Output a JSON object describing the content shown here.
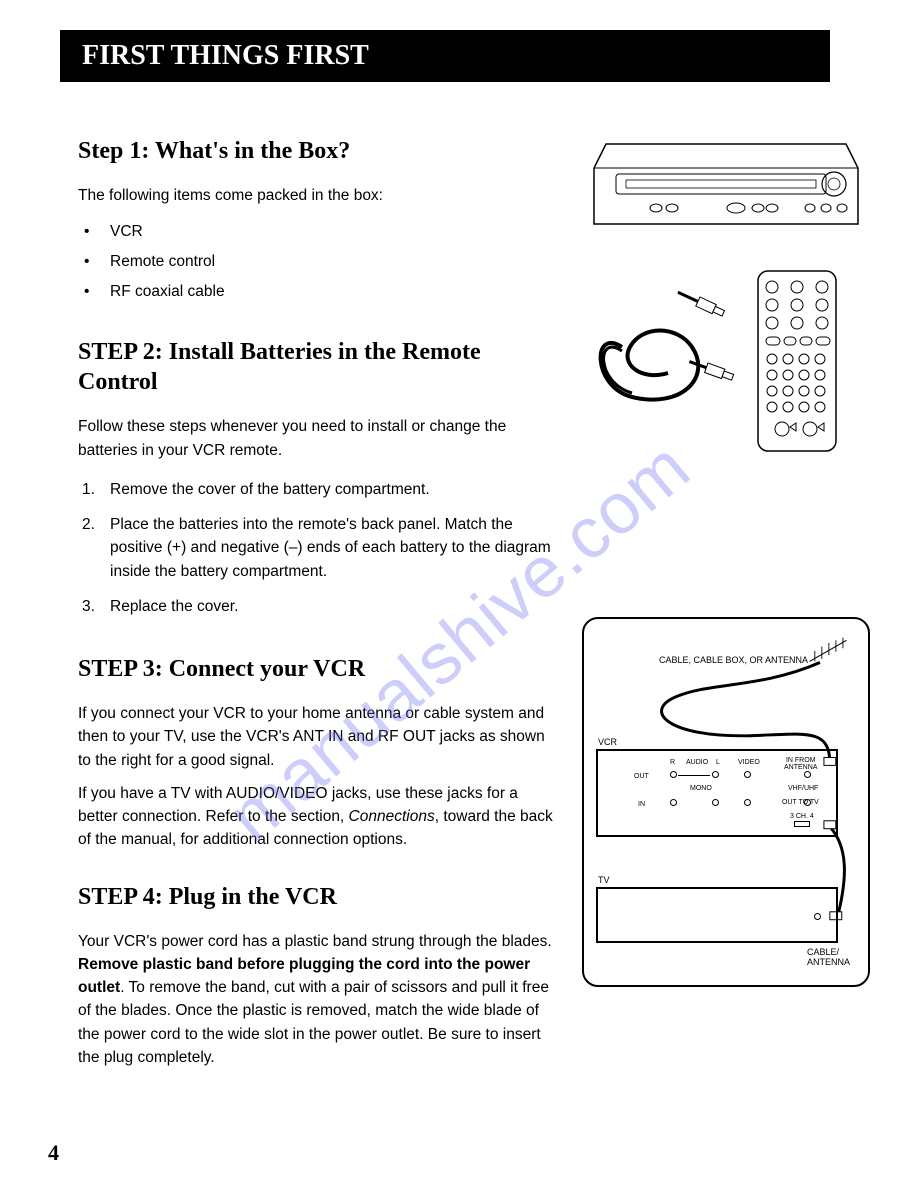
{
  "banner": "FIRST THINGS FIRST",
  "pageNumber": "4",
  "watermark": "manualshive.com",
  "step1": {
    "heading": "Step 1: What's in the Box?",
    "intro": "The following items come packed in the box:",
    "items": [
      "VCR",
      "Remote control",
      "RF coaxial cable"
    ]
  },
  "step2": {
    "heading": "STEP 2: Install Batteries in the Remote Control",
    "intro": "Follow these steps whenever you need to install or change the batteries in your VCR remote.",
    "items": [
      "Remove the cover of the battery compartment.",
      "Place the batteries into the remote's back panel. Match the positive (+) and negative (–) ends of each battery to the diagram inside the battery compartment.",
      "Replace the cover."
    ]
  },
  "step3": {
    "heading": "STEP 3: Connect your VCR",
    "p1": "If you connect your VCR to your home antenna or cable system and then to your TV, use the VCR's ANT IN and RF OUT jacks as shown to the right for a good signal.",
    "p2a": "If you have a TV with AUDIO/VIDEO jacks, use these jacks for a better connection. Refer to the section, ",
    "p2i": "Connections",
    "p2b": ", toward the back of the manual, for additional connection options."
  },
  "step4": {
    "heading": "STEP 4: Plug in the VCR",
    "p1a": "Your VCR's power cord has a plastic band strung through the blades. ",
    "p1b": "Remove plastic band before plugging the cord into the power outlet",
    "p1c": ". To remove the band, cut with a pair of scissors and pull it free of the blades. Once the plastic is removed, match the wide blade of the power cord to the wide slot in the power outlet. Be sure to insert the plug completely."
  },
  "diagram": {
    "topLabel": "CABLE, CABLE BOX, OR ANTENNA",
    "vcrLabel": "VCR",
    "tvLabel": "TV",
    "cableAntenna": "CABLE/\nANTENNA",
    "jacks": {
      "out": "OUT",
      "in": "IN",
      "audioR": "R",
      "audio": "AUDIO",
      "audioL": "L",
      "video": "VIDEO",
      "mono": "MONO",
      "inFrom": "IN FROM\nANTENNA",
      "vhfuhf": "VHF/UHF",
      "outTo": "OUT TO TV",
      "ch": "3 CH. 4"
    }
  }
}
